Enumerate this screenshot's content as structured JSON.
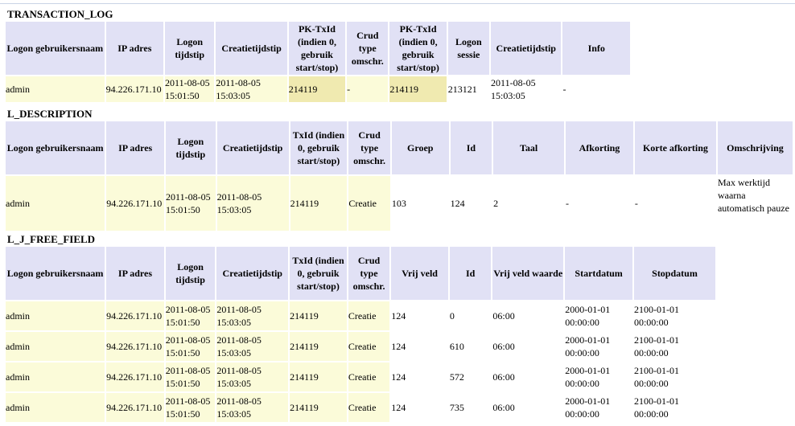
{
  "transaction_log": {
    "title": "TRANSACTION_LOG",
    "headers": [
      "Logon gebruikersnaam",
      "IP adres",
      "Logon tijdstip",
      "Creatietijdstip",
      "PK-TxId (indien 0, gebruik start/stop)",
      "Crud type omschr.",
      "PK-TxId (indien 0, gebruik start/stop)",
      "Logon sessie",
      "Creatietijdstip",
      "Info"
    ],
    "row": [
      "admin",
      "94.226.171.10",
      "2011-08-05 15:01:50",
      "2011-08-05 15:03:05",
      "214119",
      "-",
      "214119",
      "213121",
      "2011-08-05 15:03:05",
      "-"
    ]
  },
  "l_description": {
    "title": "L_DESCRIPTION",
    "headers": [
      "Logon gebruikersnaam",
      "IP adres",
      "Logon tijdstip",
      "Creatietijdstip",
      "TxId (indien 0, gebruik start/stop)",
      "Crud type omschr.",
      "Groep",
      "Id",
      "Taal",
      "Afkorting",
      "Korte afkorting",
      "Omschrijving"
    ],
    "row": [
      "admin",
      "94.226.171.10",
      "2011-08-05 15:01:50",
      "2011-08-05 15:03:05",
      "214119",
      "Creatie",
      "103",
      "124",
      "2",
      "-",
      "-",
      "Max werktijd waarna automatisch pauze"
    ]
  },
  "l_j_free_field": {
    "title": "L_J_FREE_FIELD",
    "headers": [
      "Logon gebruikersnaam",
      "IP adres",
      "Logon tijdstip",
      "Creatietijdstip",
      "TxId (indien 0, gebruik start/stop)",
      "Crud type omschr.",
      "Vrij veld",
      "Id",
      "Vrij veld waarde",
      "Startdatum",
      "Stopdatum"
    ],
    "rows": [
      [
        "admin",
        "94.226.171.10",
        "2011-08-05 15:01:50",
        "2011-08-05 15:03:05",
        "214119",
        "Creatie",
        "124",
        "0",
        "06:00",
        "2000-01-01 00:00:00",
        "2100-01-01 00:00:00"
      ],
      [
        "admin",
        "94.226.171.10",
        "2011-08-05 15:01:50",
        "2011-08-05 15:03:05",
        "214119",
        "Creatie",
        "124",
        "610",
        "06:00",
        "2000-01-01 00:00:00",
        "2100-01-01 00:00:00"
      ],
      [
        "admin",
        "94.226.171.10",
        "2011-08-05 15:01:50",
        "2011-08-05 15:03:05",
        "214119",
        "Creatie",
        "124",
        "572",
        "06:00",
        "2000-01-01 00:00:00",
        "2100-01-01 00:00:00"
      ],
      [
        "admin",
        "94.226.171.10",
        "2011-08-05 15:01:50",
        "2011-08-05 15:03:05",
        "214119",
        "Creatie",
        "124",
        "735",
        "06:00",
        "2000-01-01 00:00:00",
        "2100-01-01 00:00:00"
      ]
    ]
  }
}
